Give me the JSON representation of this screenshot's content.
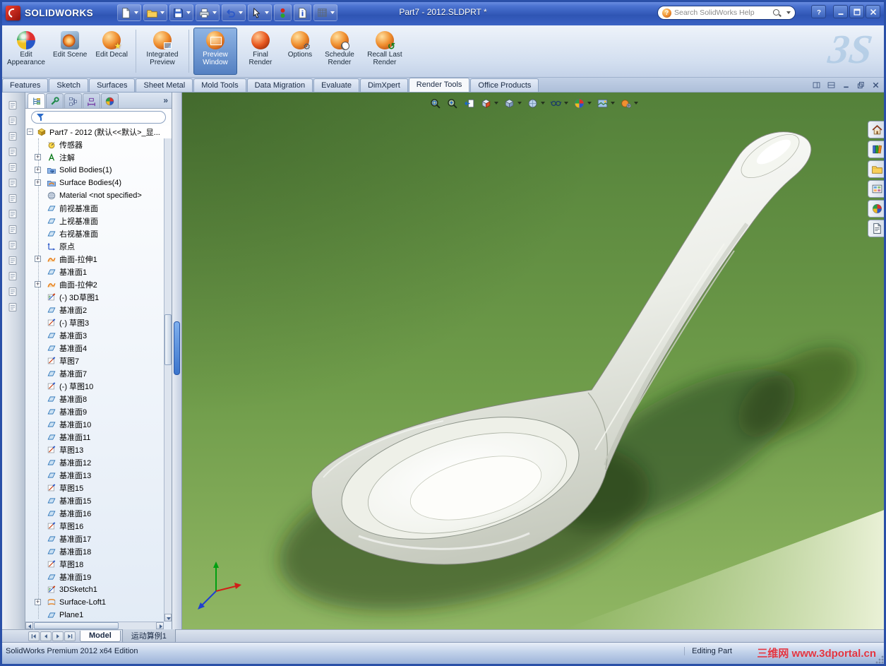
{
  "titlebar": {
    "brand": "SOLIDWORKS",
    "title": "Part7 - 2012.SLDPRT *",
    "search_placeholder": "Search SolidWorks Help",
    "toolbar": [
      {
        "icon": "new",
        "caret": true
      },
      {
        "icon": "open",
        "caret": true
      },
      {
        "icon": "save",
        "caret": true
      },
      {
        "icon": "print",
        "caret": true
      },
      {
        "icon": "undo",
        "caret": true
      },
      {
        "icon": "select",
        "caret": true
      },
      {
        "icon": "rebuild",
        "caret": false
      },
      {
        "icon": "file-properties",
        "caret": false
      },
      {
        "icon": "options",
        "caret": true
      }
    ],
    "window_controls": [
      "help",
      "minimize",
      "maximize",
      "close"
    ]
  },
  "ribbon": {
    "ds_logo": "3S",
    "buttons": [
      {
        "label": "Edit Appearance",
        "icon": "appearance",
        "active": false
      },
      {
        "label": "Edit Scene",
        "icon": "scene",
        "active": false
      },
      {
        "label": "Edit Decal",
        "icon": "decal",
        "active": false
      },
      {
        "label": "Integrated Preview",
        "icon": "integrated",
        "active": false,
        "group_break": true
      },
      {
        "label": "Preview Window",
        "icon": "preview",
        "active": true,
        "group_break": true
      },
      {
        "label": "Final Render",
        "icon": "final",
        "active": false
      },
      {
        "label": "Options",
        "icon": "options",
        "active": false
      },
      {
        "label": "Schedule Render",
        "icon": "schedule",
        "active": false
      },
      {
        "label": "Recall Last Render",
        "icon": "recall",
        "active": false
      }
    ]
  },
  "command_tabs": [
    {
      "label": "Features",
      "active": false
    },
    {
      "label": "Sketch",
      "active": false
    },
    {
      "label": "Surfaces",
      "active": false
    },
    {
      "label": "Sheet Metal",
      "active": false
    },
    {
      "label": "Mold Tools",
      "active": false
    },
    {
      "label": "Data Migration",
      "active": false
    },
    {
      "label": "Evaluate",
      "active": false
    },
    {
      "label": "DimXpert",
      "active": false
    },
    {
      "label": "Render Tools",
      "active": true
    },
    {
      "label": "Office Products",
      "active": false
    }
  ],
  "doc_controls": [
    "pane",
    "pane2",
    "minimize",
    "restore",
    "close"
  ],
  "left_toolbar": {
    "button_count": 14
  },
  "panel": {
    "tabs": [
      "featuremanager",
      "propertymanager",
      "configurationmanager",
      "dimxpertmanager",
      "displaymanager"
    ]
  },
  "tree": {
    "root": "Part7 - 2012 (默认<<默认>_显...",
    "items": [
      {
        "icon": "sensor",
        "label": "传感器"
      },
      {
        "icon": "annot",
        "label": "注解",
        "expand": true
      },
      {
        "icon": "bodies-solid",
        "label": "Solid Bodies(1)",
        "expand": true
      },
      {
        "icon": "bodies-surface",
        "label": "Surface Bodies(4)",
        "expand": true
      },
      {
        "icon": "material",
        "label": "Material <not specified>"
      },
      {
        "icon": "plane",
        "label": "前视基准面"
      },
      {
        "icon": "plane",
        "label": "上视基准面"
      },
      {
        "icon": "plane",
        "label": "右视基准面"
      },
      {
        "icon": "origin",
        "label": "原点"
      },
      {
        "icon": "surfext",
        "label": "曲面-拉伸1",
        "expand": true
      },
      {
        "icon": "plane",
        "label": "基准面1"
      },
      {
        "icon": "surfext",
        "label": "曲面-拉伸2",
        "expand": true
      },
      {
        "icon": "sketch3d",
        "label": "(-) 3D草图1"
      },
      {
        "icon": "plane",
        "label": "基准面2"
      },
      {
        "icon": "sketch",
        "label": "(-) 草图3"
      },
      {
        "icon": "plane",
        "label": "基准面3"
      },
      {
        "icon": "plane",
        "label": "基准面4"
      },
      {
        "icon": "sketch",
        "label": "草图7"
      },
      {
        "icon": "plane",
        "label": "基准面7"
      },
      {
        "icon": "sketch",
        "label": "(-) 草图10"
      },
      {
        "icon": "plane",
        "label": "基准面8"
      },
      {
        "icon": "plane",
        "label": "基准面9"
      },
      {
        "icon": "plane",
        "label": "基准面10"
      },
      {
        "icon": "plane",
        "label": "基准面11"
      },
      {
        "icon": "sketch",
        "label": "草图13"
      },
      {
        "icon": "plane",
        "label": "基准面12"
      },
      {
        "icon": "plane",
        "label": "基准面13"
      },
      {
        "icon": "sketch",
        "label": "草图15"
      },
      {
        "icon": "plane",
        "label": "基准面15"
      },
      {
        "icon": "plane",
        "label": "基准面16"
      },
      {
        "icon": "sketch",
        "label": "草图16"
      },
      {
        "icon": "plane",
        "label": "基准面17"
      },
      {
        "icon": "plane",
        "label": "基准面18"
      },
      {
        "icon": "sketch",
        "label": "草图18"
      },
      {
        "icon": "plane",
        "label": "基准面19"
      },
      {
        "icon": "sketch3d",
        "label": "3DSketch1"
      },
      {
        "icon": "loft",
        "label": "Surface-Loft1",
        "expand": true
      },
      {
        "icon": "plane",
        "label": "Plane1"
      }
    ]
  },
  "viewport": {
    "hud": [
      {
        "icon": "zoom-fit",
        "caret": false
      },
      {
        "icon": "zoom-area",
        "caret": false
      },
      {
        "icon": "previous-view",
        "caret": false
      },
      {
        "icon": "section-view",
        "caret": true
      },
      {
        "icon": "view-orientation",
        "caret": true
      },
      {
        "icon": "display-style",
        "caret": true
      },
      {
        "icon": "hide-show-items",
        "caret": true
      },
      {
        "icon": "edit-appearance",
        "caret": true
      },
      {
        "icon": "apply-scene",
        "caret": true
      },
      {
        "icon": "view-settings",
        "caret": true
      }
    ],
    "task_pane": [
      "solidworks-resources",
      "design-library",
      "file-explorer",
      "view-palette",
      "appearances-scenes",
      "custom-properties"
    ]
  },
  "bottom_tabs": {
    "nav": [
      "first",
      "previous",
      "next",
      "last"
    ],
    "model": "Model",
    "motion": "运动算例1"
  },
  "statusbar": {
    "left": "SolidWorks Premium 2012 x64 Edition",
    "right": "Editing Part"
  },
  "watermark": "三维网 www.3dportal.cn",
  "colors": {
    "viewport_green": "#6f9c4a",
    "titlebar_blue": "#2f55b4",
    "render_orange": "#f09030"
  }
}
